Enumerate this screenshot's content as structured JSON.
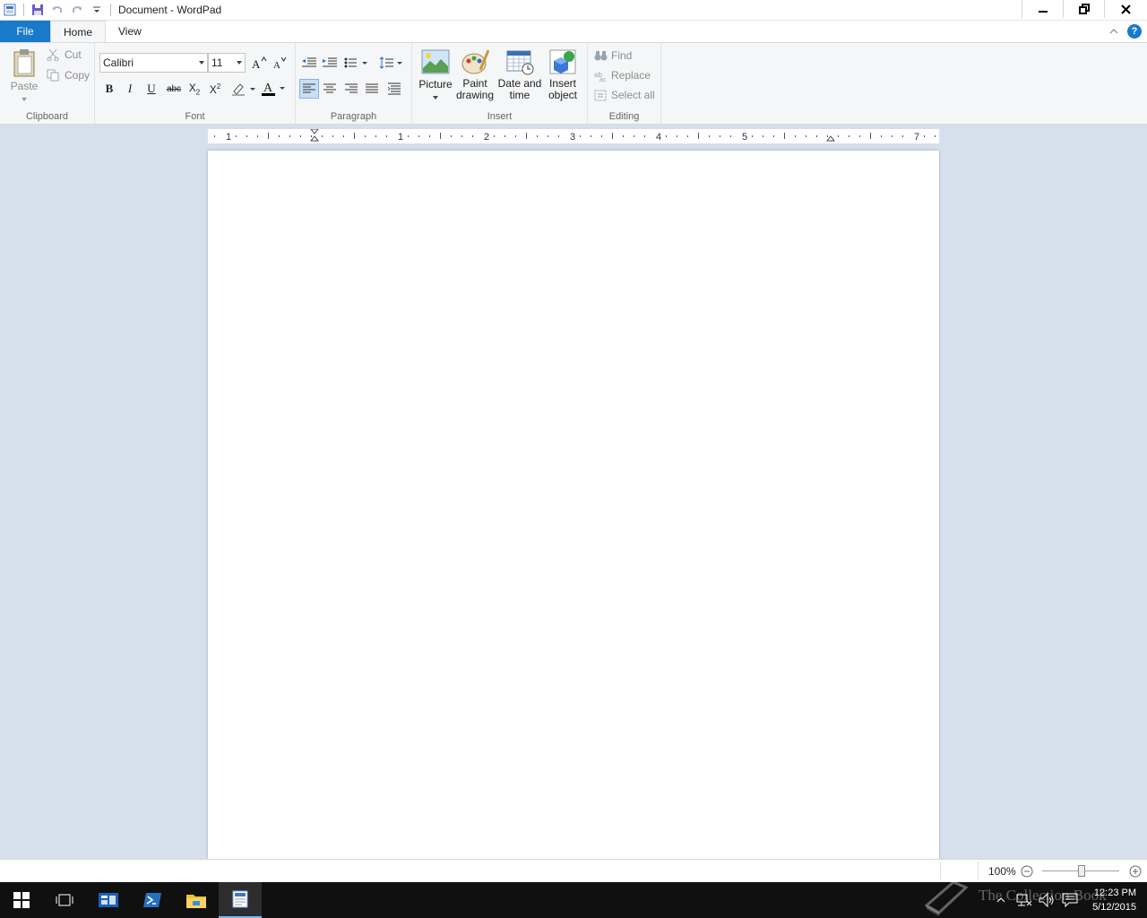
{
  "window": {
    "title": "Document - WordPad"
  },
  "tabs": {
    "file": "File",
    "home": "Home",
    "view": "View"
  },
  "ribbon": {
    "clipboard": {
      "label": "Clipboard",
      "paste": "Paste",
      "cut": "Cut",
      "copy": "Copy"
    },
    "font": {
      "label": "Font",
      "family": "Calibri",
      "size": "11"
    },
    "paragraph": {
      "label": "Paragraph"
    },
    "insert": {
      "label": "Insert",
      "picture": "Picture",
      "paint_line1": "Paint",
      "paint_line2": "drawing",
      "date_line1": "Date and",
      "date_line2": "time",
      "object_line1": "Insert",
      "object_line2": "object"
    },
    "editing": {
      "label": "Editing",
      "find": "Find",
      "replace": "Replace",
      "select_all": "Select all"
    }
  },
  "ruler": {
    "numbers": [
      "1",
      "1",
      "2",
      "3",
      "4",
      "5",
      "7"
    ]
  },
  "statusbar": {
    "zoom": "100%",
    "zoom_level": 1.0
  },
  "taskbar": {
    "time": "12:23 PM",
    "date": "5/12/2015",
    "watermark": "The Collection Book"
  },
  "colors": {
    "accent": "#1979ca",
    "workspace": "#d6e0ec",
    "taskbar": "#101010"
  }
}
